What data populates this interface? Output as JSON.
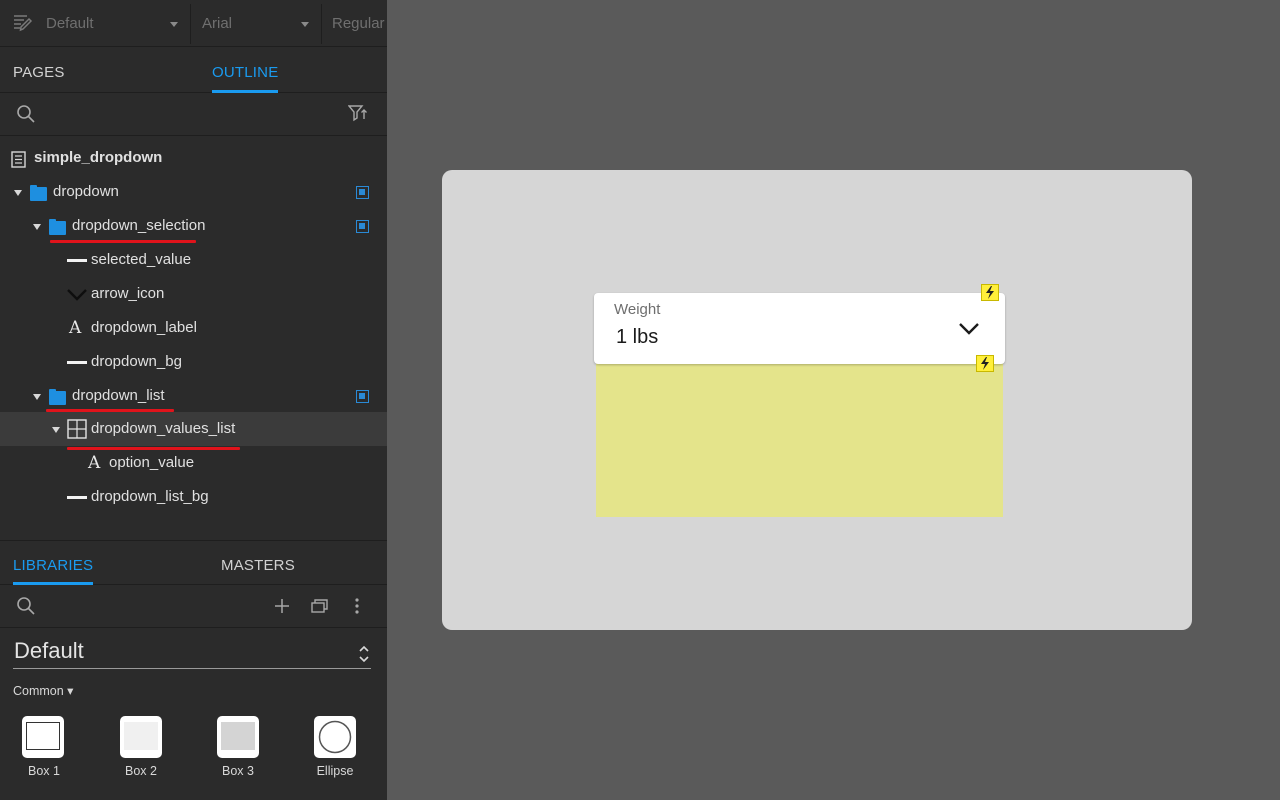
{
  "toolbar": {
    "style_select": "Default",
    "font_select": "Arial",
    "weight_select": "Regular"
  },
  "top_tabs": [
    {
      "label": "PAGES",
      "active": false
    },
    {
      "label": "OUTLINE",
      "active": true
    }
  ],
  "outline": {
    "search_placeholder": "",
    "page": "simple_dropdown",
    "items": [
      {
        "label": "dropdown",
        "type": "folder"
      },
      {
        "label": "dropdown_selection",
        "type": "folder"
      },
      {
        "label": "selected_value",
        "type": "line"
      },
      {
        "label": "arrow_icon",
        "type": "arrow"
      },
      {
        "label": "dropdown_label",
        "type": "text"
      },
      {
        "label": "dropdown_bg",
        "type": "line"
      },
      {
        "label": "dropdown_list",
        "type": "folder"
      },
      {
        "label": "dropdown_values_list",
        "type": "repeater"
      },
      {
        "label": "option_value",
        "type": "text"
      },
      {
        "label": "dropdown_list_bg",
        "type": "line"
      }
    ]
  },
  "library_tabs": [
    {
      "label": "LIBRARIES",
      "active": true
    },
    {
      "label": "MASTERS",
      "active": false
    }
  ],
  "library": {
    "selected": "Default",
    "group": "Common ▾",
    "widgets": [
      {
        "label": "Box 1"
      },
      {
        "label": "Box 2"
      },
      {
        "label": "Box 3"
      },
      {
        "label": "Ellipse"
      }
    ]
  },
  "canvas": {
    "dropdown_label": "Weight",
    "dropdown_value": "1 lbs"
  },
  "colors": {
    "accent": "#1a9bf0",
    "folder": "#1e8fe0",
    "highlight_underline": "#e0131b",
    "list_bg": "#e4e48b",
    "interaction_badge": "#ffef3a"
  }
}
